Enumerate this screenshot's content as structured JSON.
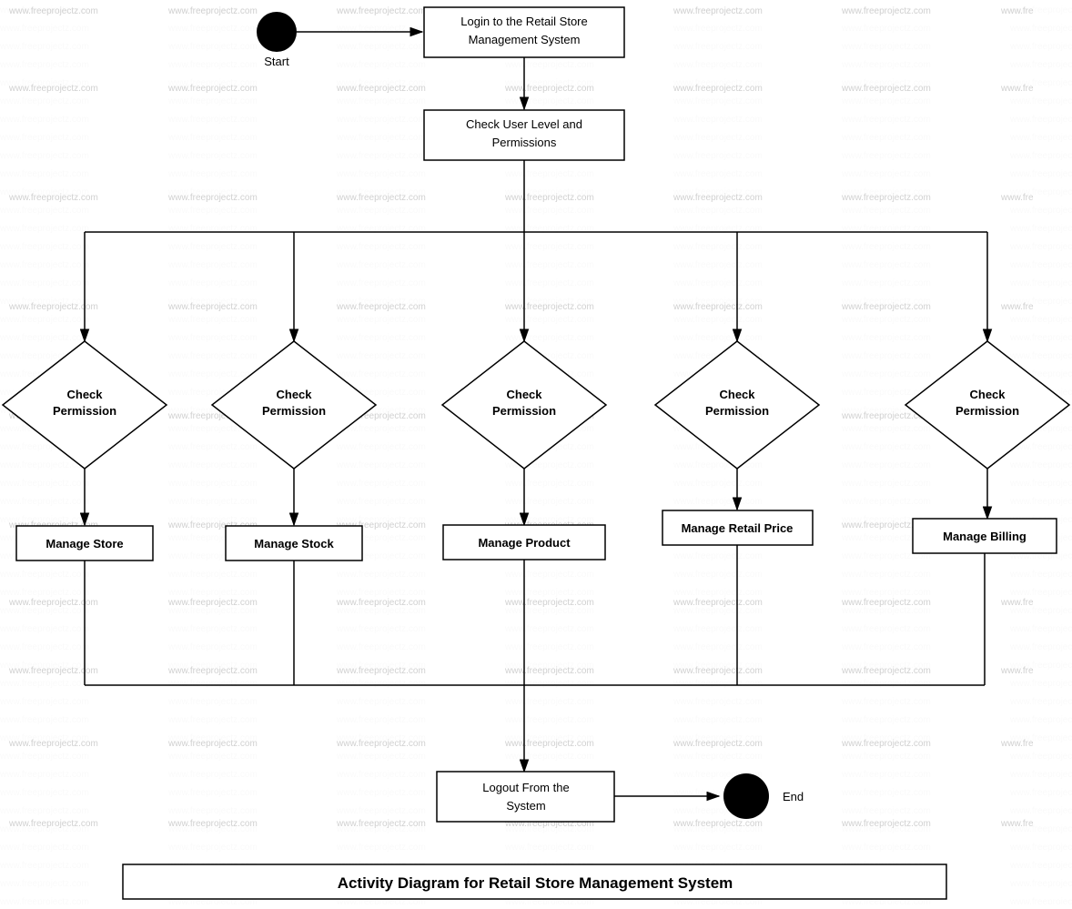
{
  "diagram": {
    "title": "Activity Diagram for Retail Store Management System",
    "watermark": "www.freeprojectz.com",
    "nodes": {
      "start": {
        "label": "Start"
      },
      "login": {
        "label": "Login to the Retail Store\nManagement System"
      },
      "check_user": {
        "label": "Check User Level and\nPermissions"
      },
      "check_perm1": {
        "label": "Check\nPermission"
      },
      "check_perm2": {
        "label": "Check\nPermission"
      },
      "check_perm3": {
        "label": "Check\nPermission"
      },
      "check_perm4": {
        "label": "Check\nPermission"
      },
      "check_perm5": {
        "label": "Check\nPermission"
      },
      "manage_store": {
        "label": "Manage Store"
      },
      "manage_stock": {
        "label": "Manage Stock"
      },
      "manage_product": {
        "label": "Manage Product"
      },
      "manage_retail": {
        "label": "Manage Retail Price"
      },
      "manage_billing": {
        "label": "Manage Billing"
      },
      "logout": {
        "label": "Logout From the\nSystem"
      },
      "end": {
        "label": "End"
      }
    }
  }
}
